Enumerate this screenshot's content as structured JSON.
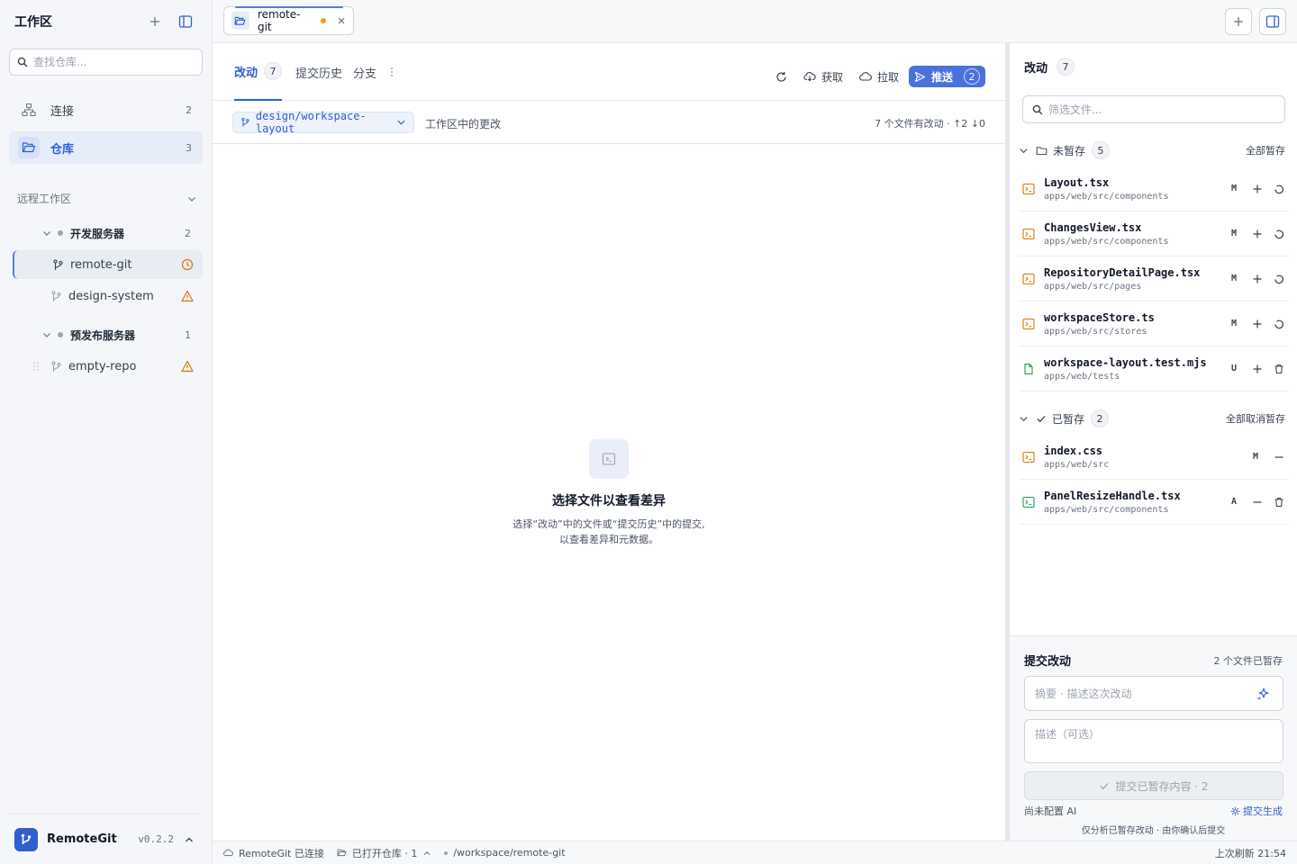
{
  "sidebar": {
    "title": "工作区",
    "search_placeholder": "查找仓库...",
    "nav": [
      {
        "label": "连接",
        "count": "2"
      },
      {
        "label": "仓库",
        "count": "3"
      }
    ],
    "remote_section_label": "远程工作区",
    "servers": [
      {
        "name": "开发服务器",
        "count": "2",
        "repos": [
          {
            "name": "remote-git"
          },
          {
            "name": "design-system"
          }
        ]
      },
      {
        "name": "预发布服务器",
        "count": "1",
        "repos": [
          {
            "name": "empty-repo"
          }
        ]
      }
    ],
    "app_name": "RemoteGit",
    "version": "v0.2.2"
  },
  "tab": {
    "label": "remote-git"
  },
  "main": {
    "tabs": [
      {
        "label": "改动",
        "count": "7"
      },
      {
        "label": "提交历史"
      },
      {
        "label": "分支"
      }
    ],
    "fetch_label": "获取",
    "pull_label": "拉取",
    "push_label": "推送",
    "push_count": "2",
    "branch": "design/workspace-layout",
    "branch_desc": "工作区中的更改",
    "branch_stats": "7 个文件有改动 · ↑2 ↓0",
    "empty_title": "选择文件以查看差异",
    "empty_line1": "选择“改动”中的文件或“提交历史”中的提交,",
    "empty_line2": "以查看差异和元数据。"
  },
  "changes": {
    "title": "改动",
    "count": "7",
    "filter_placeholder": "筛选文件...",
    "unstaged": {
      "label": "未暂存",
      "count": "5",
      "action": "全部暂存",
      "files": [
        {
          "name": "Layout.tsx",
          "path": "apps/web/src/components",
          "status": "M"
        },
        {
          "name": "ChangesView.tsx",
          "path": "apps/web/src/components",
          "status": "M"
        },
        {
          "name": "RepositoryDetailPage.tsx",
          "path": "apps/web/src/pages",
          "status": "M"
        },
        {
          "name": "workspaceStore.ts",
          "path": "apps/web/src/stores",
          "status": "M"
        },
        {
          "name": "workspace-layout.test.mjs",
          "path": "apps/web/tests",
          "status": "U"
        }
      ]
    },
    "staged": {
      "label": "已暂存",
      "count": "2",
      "action": "全部取消暂存",
      "files": [
        {
          "name": "index.css",
          "path": "apps/web/src",
          "status": "M"
        },
        {
          "name": "PanelResizeHandle.tsx",
          "path": "apps/web/src/components",
          "status": "A"
        }
      ]
    }
  },
  "commit": {
    "title": "提交改动",
    "note": "2 个文件已暂存",
    "summary_placeholder": "摘要 · 描述这次改动",
    "desc_placeholder": "描述（可选）",
    "button_label": "提交已暂存内容 · 2",
    "ai_status": "尚未配置 AI",
    "ai_link": "提交生成",
    "hint": "仅分析已暂存改动 · 由你确认后提交"
  },
  "statusbar": {
    "connection": "RemoteGit 已连接",
    "open_repos": "已打开仓库 · 1",
    "path": "/workspace/remote-git",
    "refreshed": "上次刷新 21:54"
  },
  "colors": {
    "accent": "#2f5fd0",
    "push": "#4a72dd",
    "modified": "#d97706",
    "added": "#16a34a",
    "warning": "#d97706"
  }
}
